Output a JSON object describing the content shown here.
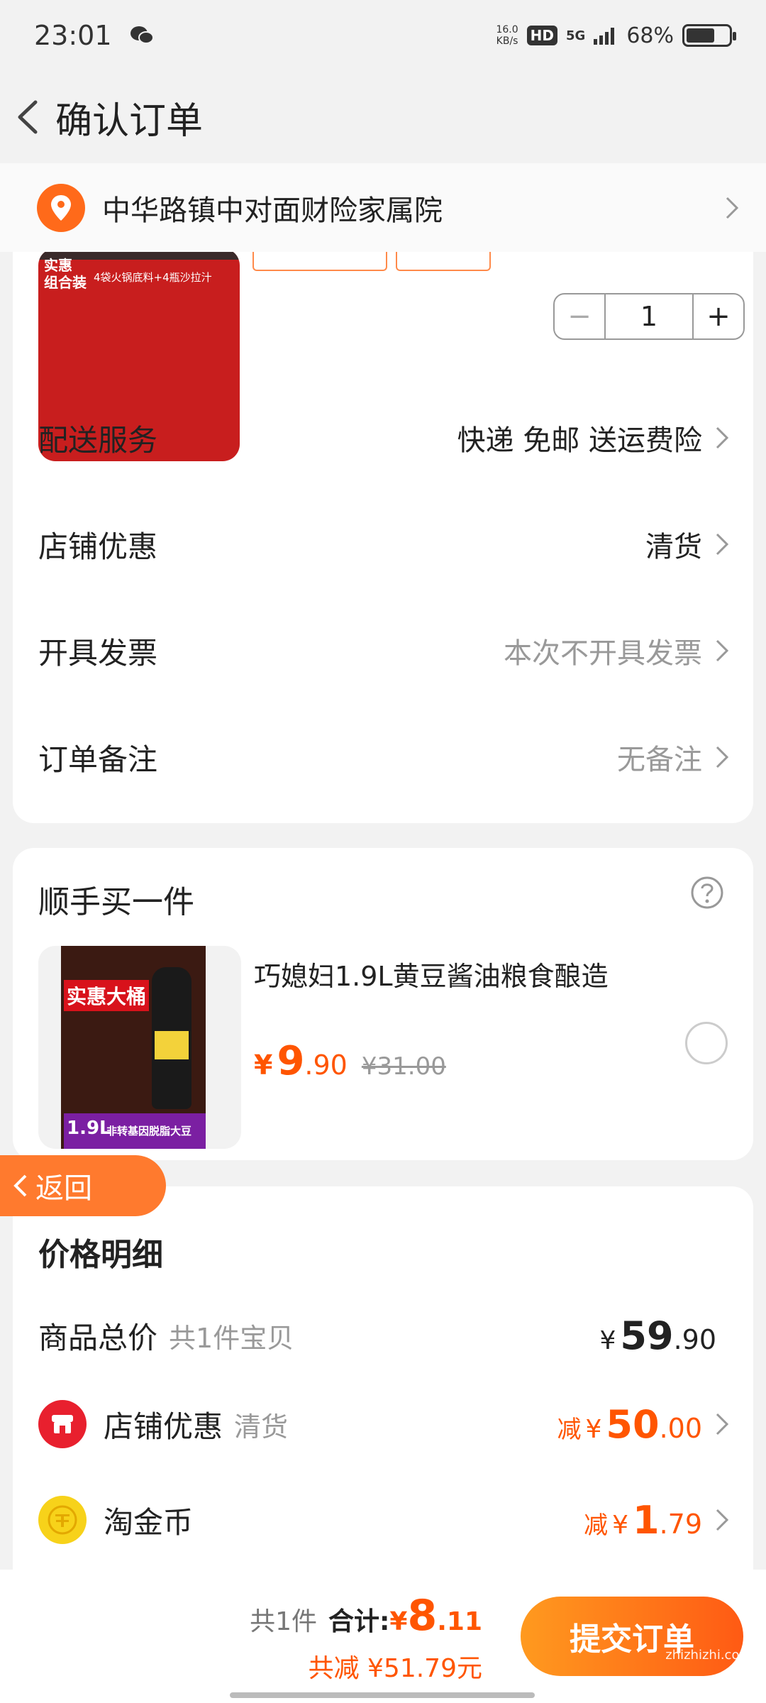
{
  "status_bar": {
    "time": "23:01",
    "speed_value": "16.0",
    "speed_unit": "KB/s",
    "hd_badge": "HD",
    "network": "5G",
    "battery": "68%",
    "battery_level": 0.68
  },
  "nav": {
    "title": "确认订单"
  },
  "address": {
    "text": "中华路镇中对面财险家属院"
  },
  "product": {
    "image_text_top": "实惠",
    "image_text_bottom": "组合装",
    "image_caption": "4袋火锅底料+4瓶沙拉汁",
    "quantity": "1"
  },
  "order_options": [
    {
      "label": "配送服务",
      "value": "快递 免邮 送运费险",
      "style": "dark"
    },
    {
      "label": "店铺优惠",
      "value": "清货",
      "style": "dark"
    },
    {
      "label": "开具发票",
      "value": "本次不开具发票",
      "style": "gray"
    },
    {
      "label": "订单备注",
      "value": "无备注",
      "style": "gray"
    }
  ],
  "add_on": {
    "heading": "顺手买一件",
    "product_name": "巧媳妇1.9L黄豆酱油粮食酿造",
    "price_yen": "¥",
    "price_int": "9",
    "price_dec": ".90",
    "old_price": "¥31.00",
    "thumb_text1": "实惠大桶",
    "thumb_text2": "1.9L",
    "thumb_text3": "非转基因脱脂大豆"
  },
  "float_back": {
    "label": "返回"
  },
  "price_detail": {
    "heading": "价格明细",
    "goods_total_label": "商品总价",
    "goods_total_sub": "共1件宝贝",
    "goods_total_yen": "¥",
    "goods_total_int": "59",
    "goods_total_dec": ".90",
    "shop_discount_label": "店铺优惠",
    "shop_discount_sub": "清货",
    "shop_discount_prefix": "减",
    "shop_discount_yen": "¥",
    "shop_discount_int": "50",
    "shop_discount_dec": ".00",
    "coin_label": "淘金币",
    "coin_prefix": "减",
    "coin_yen": "¥",
    "coin_int": "1",
    "coin_dec": ".79"
  },
  "bottom_bar": {
    "count": "共1件",
    "total_label": "合计:",
    "total_yen": "¥",
    "total_int": "8",
    "total_dec": ".11",
    "saved": "共减 ¥51.79元",
    "submit": "提交订单",
    "watermark": "zhizhizhi.com"
  },
  "colors": {
    "accent": "#ff5500",
    "button_start": "#ff9a1f",
    "button_end": "#ff5a14"
  }
}
